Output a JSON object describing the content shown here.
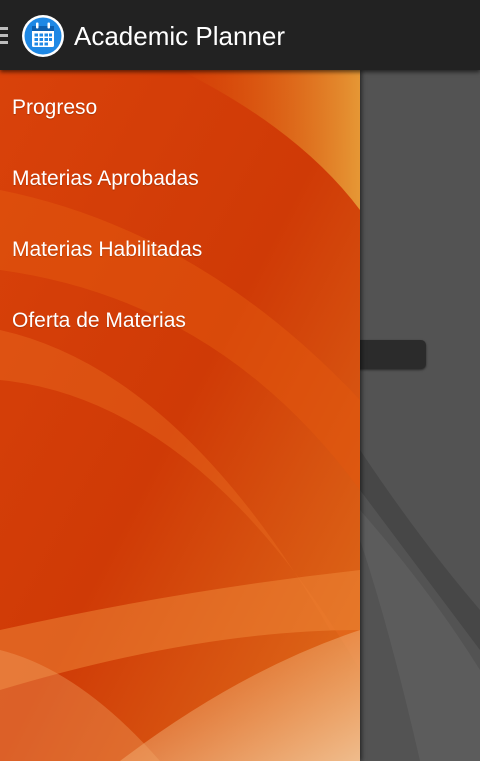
{
  "action_bar": {
    "title": "Academic Planner",
    "app_icon": "calendar-icon",
    "toggle_icon": "hamburger-icon",
    "background": "#222222"
  },
  "drawer": {
    "items": [
      {
        "label": "Progreso"
      },
      {
        "label": "Materias Aprobadas"
      },
      {
        "label": "Materias Habilitadas"
      },
      {
        "label": "Oferta de Materias"
      }
    ],
    "accent": "#d94a0c"
  },
  "colors": {
    "icon_blue": "#1e88e5",
    "text": "#ffffff"
  }
}
